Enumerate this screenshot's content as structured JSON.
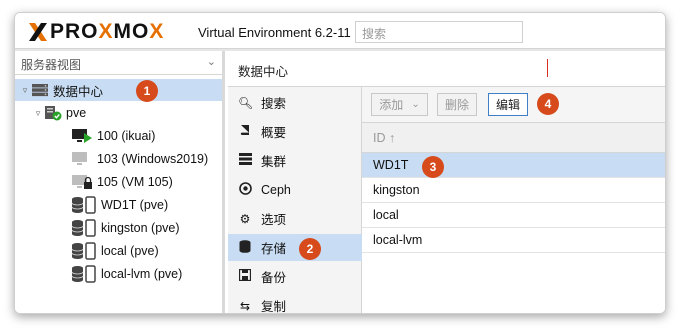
{
  "header": {
    "brand_left": "PRO",
    "brand_ox": "X",
    "brand_mid": "MO",
    "brand_right": "X",
    "version": "Virtual Environment 6.2-11",
    "search_placeholder": "搜索"
  },
  "tree": {
    "view_label": "服务器视图",
    "items": [
      {
        "label": "数据中心",
        "icon": "datacenter-icon"
      },
      {
        "label": "pve",
        "icon": "node-online-icon"
      },
      {
        "label": "100 (ikuai)",
        "icon": "vm-running-icon"
      },
      {
        "label": "103 (Windows2019)",
        "icon": "vm-stopped-icon"
      },
      {
        "label": "105 (VM 105)",
        "icon": "vm-locked-icon"
      },
      {
        "label": "WD1T (pve)",
        "icon": "storage-icon"
      },
      {
        "label": "kingston (pve)",
        "icon": "storage-icon"
      },
      {
        "label": "local (pve)",
        "icon": "storage-icon"
      },
      {
        "label": "local-lvm (pve)",
        "icon": "storage-icon"
      }
    ]
  },
  "content": {
    "title": "数据中心"
  },
  "nav": {
    "items": [
      {
        "label": "搜索",
        "icon": "search-icon"
      },
      {
        "label": "概要",
        "icon": "book-icon"
      },
      {
        "label": "集群",
        "icon": "server-icon"
      },
      {
        "label": "Ceph",
        "icon": "ceph-icon"
      },
      {
        "label": "选项",
        "icon": "gear-icon"
      },
      {
        "label": "存储",
        "icon": "database-icon"
      },
      {
        "label": "备份",
        "icon": "floppy-icon"
      },
      {
        "label": "复制",
        "icon": "retweet-icon"
      }
    ]
  },
  "toolbar": {
    "add_label": "添加",
    "remove_label": "删除",
    "edit_label": "编辑"
  },
  "grid": {
    "column_header": "ID ↑",
    "rows": [
      "WD1T",
      "kingston",
      "local",
      "local-lvm"
    ]
  },
  "callouts": [
    "1",
    "2",
    "3",
    "4"
  ],
  "colors": {
    "accent_orange": "#e57000",
    "selection_blue": "#c8ddf3",
    "callout_red": "#d64a1c",
    "edit_border": "#3f7fc5"
  }
}
